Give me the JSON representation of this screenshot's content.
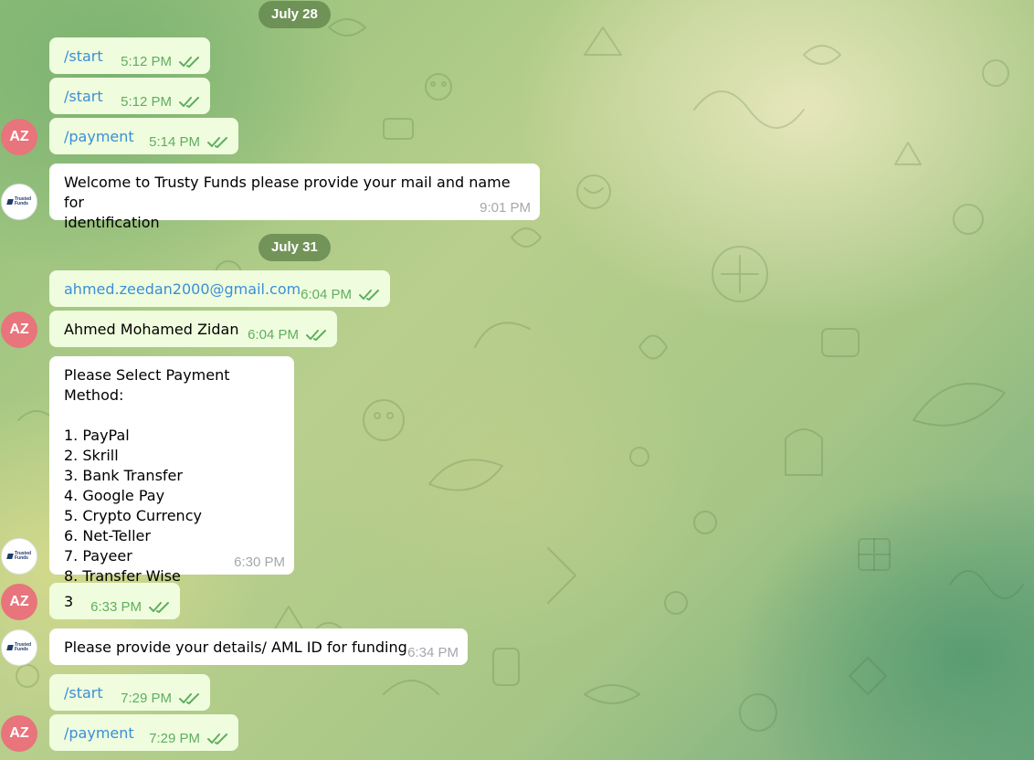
{
  "colors": {
    "outgoing_bubble": "#effdde",
    "incoming_bubble": "#ffffff",
    "command_link": "#3a8fd6",
    "user_avatar": "#e8747c",
    "read_checkmarks": "#5fae5f"
  },
  "user_avatar_initials": "AZ",
  "bot_avatar_text": "Trusted\nFunds",
  "dates": [
    "July 28",
    "July 31"
  ],
  "messages": [
    {
      "text": "/start",
      "time": "5:12 PM",
      "direction": "out",
      "is_command": true,
      "read": true
    },
    {
      "text": "/start",
      "time": "5:12 PM",
      "direction": "out",
      "is_command": true,
      "read": true
    },
    {
      "text": "/payment",
      "time": "5:14 PM",
      "direction": "out",
      "is_command": true,
      "read": true
    },
    {
      "text": "Welcome to Trusty Funds please provide your mail and name for\nidentification",
      "time": "9:01 PM",
      "direction": "in"
    },
    {
      "text": "ahmed.zeedan2000@gmail.com",
      "time": "6:04 PM",
      "direction": "out",
      "is_link": true,
      "read": true
    },
    {
      "text": "Ahmed Mohamed Zidan",
      "time": "6:04 PM",
      "direction": "out",
      "read": true
    },
    {
      "text": "Please Select Payment Method:\n\n1. PayPal\n2. Skrill\n3. Bank Transfer\n4. Google Pay\n5. Crypto Currency\n6. Net-Teller\n7. Payeer\n8. Transfer Wise",
      "time": "6:30 PM",
      "direction": "in"
    },
    {
      "text": "3",
      "time": "6:33 PM",
      "direction": "out",
      "read": true
    },
    {
      "text": "Please provide your details/ AML ID for funding",
      "time": "6:34 PM",
      "direction": "in"
    },
    {
      "text": "/start",
      "time": "7:29 PM",
      "direction": "out",
      "is_command": true,
      "read": true
    },
    {
      "text": "/payment",
      "time": "7:29 PM",
      "direction": "out",
      "is_command": true,
      "read": true
    }
  ]
}
